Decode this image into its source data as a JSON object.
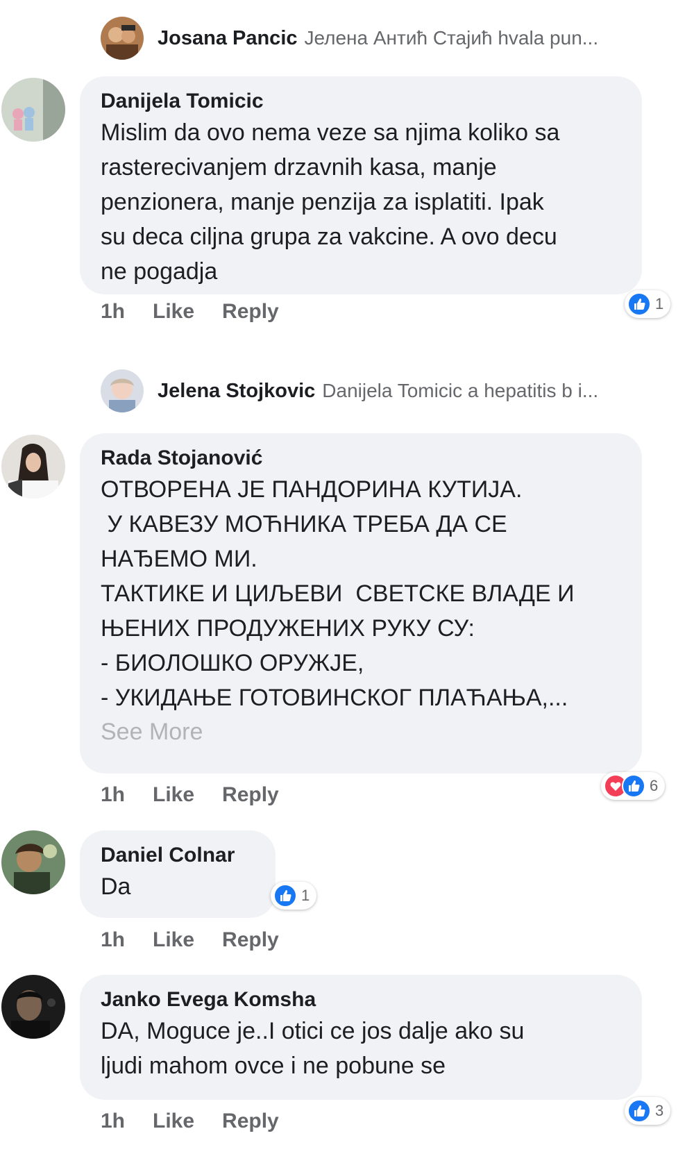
{
  "colors": {
    "bubble": "#f0f2f5",
    "meta": "#65676b",
    "like": "#1877f2",
    "love": "#f33e58",
    "see_more": "#b0b3b8"
  },
  "comments": [
    {
      "kind": "reply-collapsed",
      "author": "Josana Pancic",
      "preview": "Јелена Антић Стајић hvala pun..."
    },
    {
      "kind": "comment",
      "author": "Danijela Tomicic",
      "lines": [
        "Mislim da ovo nema veze sa njima koliko sa",
        "rasterecivanjem drzavnih kasa, manje",
        "penzionera, manje penzija za isplatiti. Ipak",
        "su deca ciljna grupa za vakcine. A ovo decu",
        "ne pogadja"
      ],
      "time": "1h",
      "like": "Like",
      "reply": "Reply",
      "reactions": {
        "icons": [
          "like-icon"
        ],
        "count": "1"
      }
    },
    {
      "kind": "reply-collapsed",
      "author": "Jelena Stojkovic",
      "preview": "Danijela Tomicic a hepatitis b i..."
    },
    {
      "kind": "comment",
      "author": "Rada Stojanović",
      "lines": [
        "ОТВОРЕНА ЈЕ ПАНДОРИНА КУТИЈА.",
        " У КАВЕЗУ МОЋНИКА ТРЕБА ДА СЕ",
        "НАЂЕМО МИ.",
        "ТАКТИКЕ И ЦИЉЕВИ  СВЕТСКЕ ВЛАДЕ И",
        "ЊЕНИХ ПРОДУЖЕНИХ РУКУ СУ:",
        "- БИОЛОШКО ОРУЖЈЕ,",
        "- УКИДАЊЕ ГОТОВИНСКОГ ПЛАЋАЊА,..."
      ],
      "see_more": "See More",
      "time": "1h",
      "like": "Like",
      "reply": "Reply",
      "reactions": {
        "icons": [
          "love-icon",
          "like-icon"
        ],
        "count": "6"
      }
    },
    {
      "kind": "comment",
      "author": "Daniel Colnar",
      "lines": [
        "Da"
      ],
      "time": "1h",
      "like": "Like",
      "reply": "Reply",
      "reactions": {
        "icons": [
          "like-icon"
        ],
        "count": "1"
      }
    },
    {
      "kind": "comment",
      "author": "Janko Evega Komsha",
      "lines": [
        "DA, Moguce je..I otici ce jos dalje ako su",
        "ljudi mahom ovce i ne pobune se"
      ],
      "time": "1h",
      "like": "Like",
      "reply": "Reply",
      "reactions": {
        "icons": [
          "like-icon"
        ],
        "count": "3"
      }
    }
  ]
}
